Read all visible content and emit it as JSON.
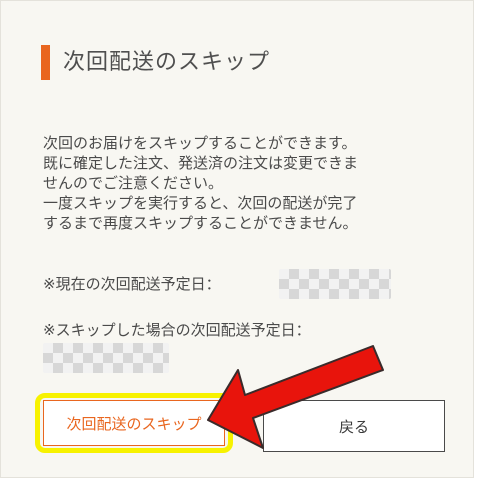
{
  "title": "次回配送のスキップ",
  "body_lines": [
    "次回のお届けをスキップすることができます。",
    "既に確定した注文、発送済の注文は変更できま",
    "せんのでご注意ください。",
    "一度スキップを実行すると、次回の配送が完了",
    "するまで再度スキップすることができません。"
  ],
  "current_date_label": "※現在の次回配送予定日：",
  "skipped_date_label": "※スキップした場合の次回配送予定日：",
  "buttons": {
    "skip_label": "次回配送のスキップ",
    "back_label": "戻る"
  },
  "colors": {
    "accent": "#e9661f",
    "highlight": "#f7f200",
    "arrow": "#e8140c"
  }
}
